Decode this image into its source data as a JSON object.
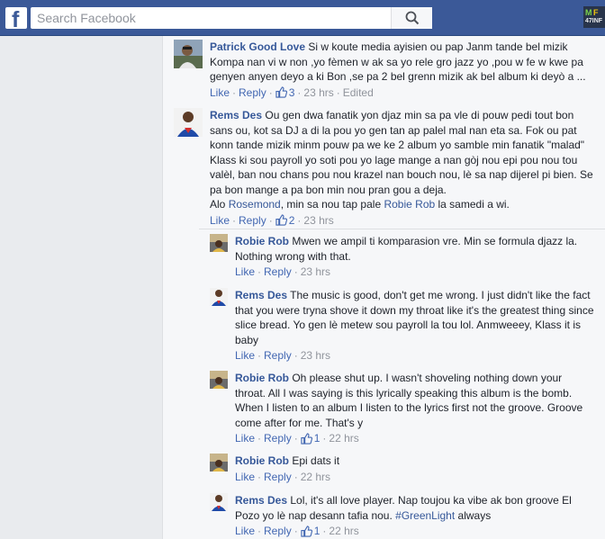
{
  "header": {
    "logo": "f",
    "search_placeholder": "Search Facebook",
    "search_icon": "search-icon",
    "account_badge": {
      "line1_a": "M",
      "line1_b": "F",
      "line2": "47INF"
    }
  },
  "actions": {
    "like": "Like",
    "reply": "Reply",
    "edited": "Edited",
    "separator": "·"
  },
  "comments": [
    {
      "author": "Patrick Good Love",
      "text": "Si w koute media ayisien ou pap Janm tande bel mizik Kompa nan vi w non ,yo fèmen w ak sa yo rele gro jazz yo ,pou w fe w kwe pa genyen anyen deyo a ki Bon ,se pa 2 bel grenn mizik ak bel album ki deyò a ...",
      "likes": "3",
      "time": "23 hrs"
    },
    {
      "author": "Rems Des",
      "text": "Ou gen dwa fanatik yon djaz min sa pa vle di pouw pedi tout bon sans ou, kot sa DJ a di la pou yo gen tan ap palel mal nan eta sa. Fok ou pat konn tande mizik minm pouw pa we ke 2 album yo samble min fanatik \"malad\" Klass ki sou payroll yo soti pou yo lage mange a nan gòj nou epi pou nou tou valèl, ban nou chans pou nou krazel nan bouch nou, lè sa nap dijerel pi bien. Se pa bon mange a pa bon min nou pran gou a deja.",
      "text_line2_prefix": "Alo ",
      "mention1": "Rosemond",
      "text_line2_mid": ", min sa nou tap pale ",
      "mention2": "Robie Rob",
      "text_line2_suffix": " la samedi a wi.",
      "likes": "2",
      "time": "23 hrs"
    }
  ],
  "replies": [
    {
      "author": "Robie Rob",
      "text": "Mwen we ampil ti komparasion vre. Min se formula djazz la. Nothing wrong with that.",
      "time": "23 hrs"
    },
    {
      "author": "Rems Des",
      "text": "The music is good, don't get me wrong. I just didn't like the fact that you were tryna shove it down my throat like it's the greatest thing since slice bread. Yo gen lè metew sou payroll la tou lol. Anmweeey, Klass it is baby",
      "time": "23 hrs"
    },
    {
      "author": "Robie Rob",
      "text": "Oh please shut up. I wasn't shoveling nothing down your throat. All I was saying is this lyrically speaking this album is the bomb. When I listen to an album I listen to the lyrics first not the groove. Groove come after for me. That's y",
      "likes": "1",
      "time": "22 hrs"
    },
    {
      "author": "Robie Rob",
      "text": "Epi dats it",
      "time": "22 hrs"
    },
    {
      "author": "Rems Des",
      "text": "Lol, it's all love player. Nap toujou ka vibe ak bon groove El Pozo yo lè nap desann tafia nou. ",
      "hashtag": "#GreenLight",
      "text_suffix": " always",
      "likes": "1",
      "time": "22 hrs"
    }
  ],
  "colors": {
    "header": "#3b5998",
    "link": "#365899",
    "muted": "#90949c",
    "panel": "#f6f7f9"
  }
}
